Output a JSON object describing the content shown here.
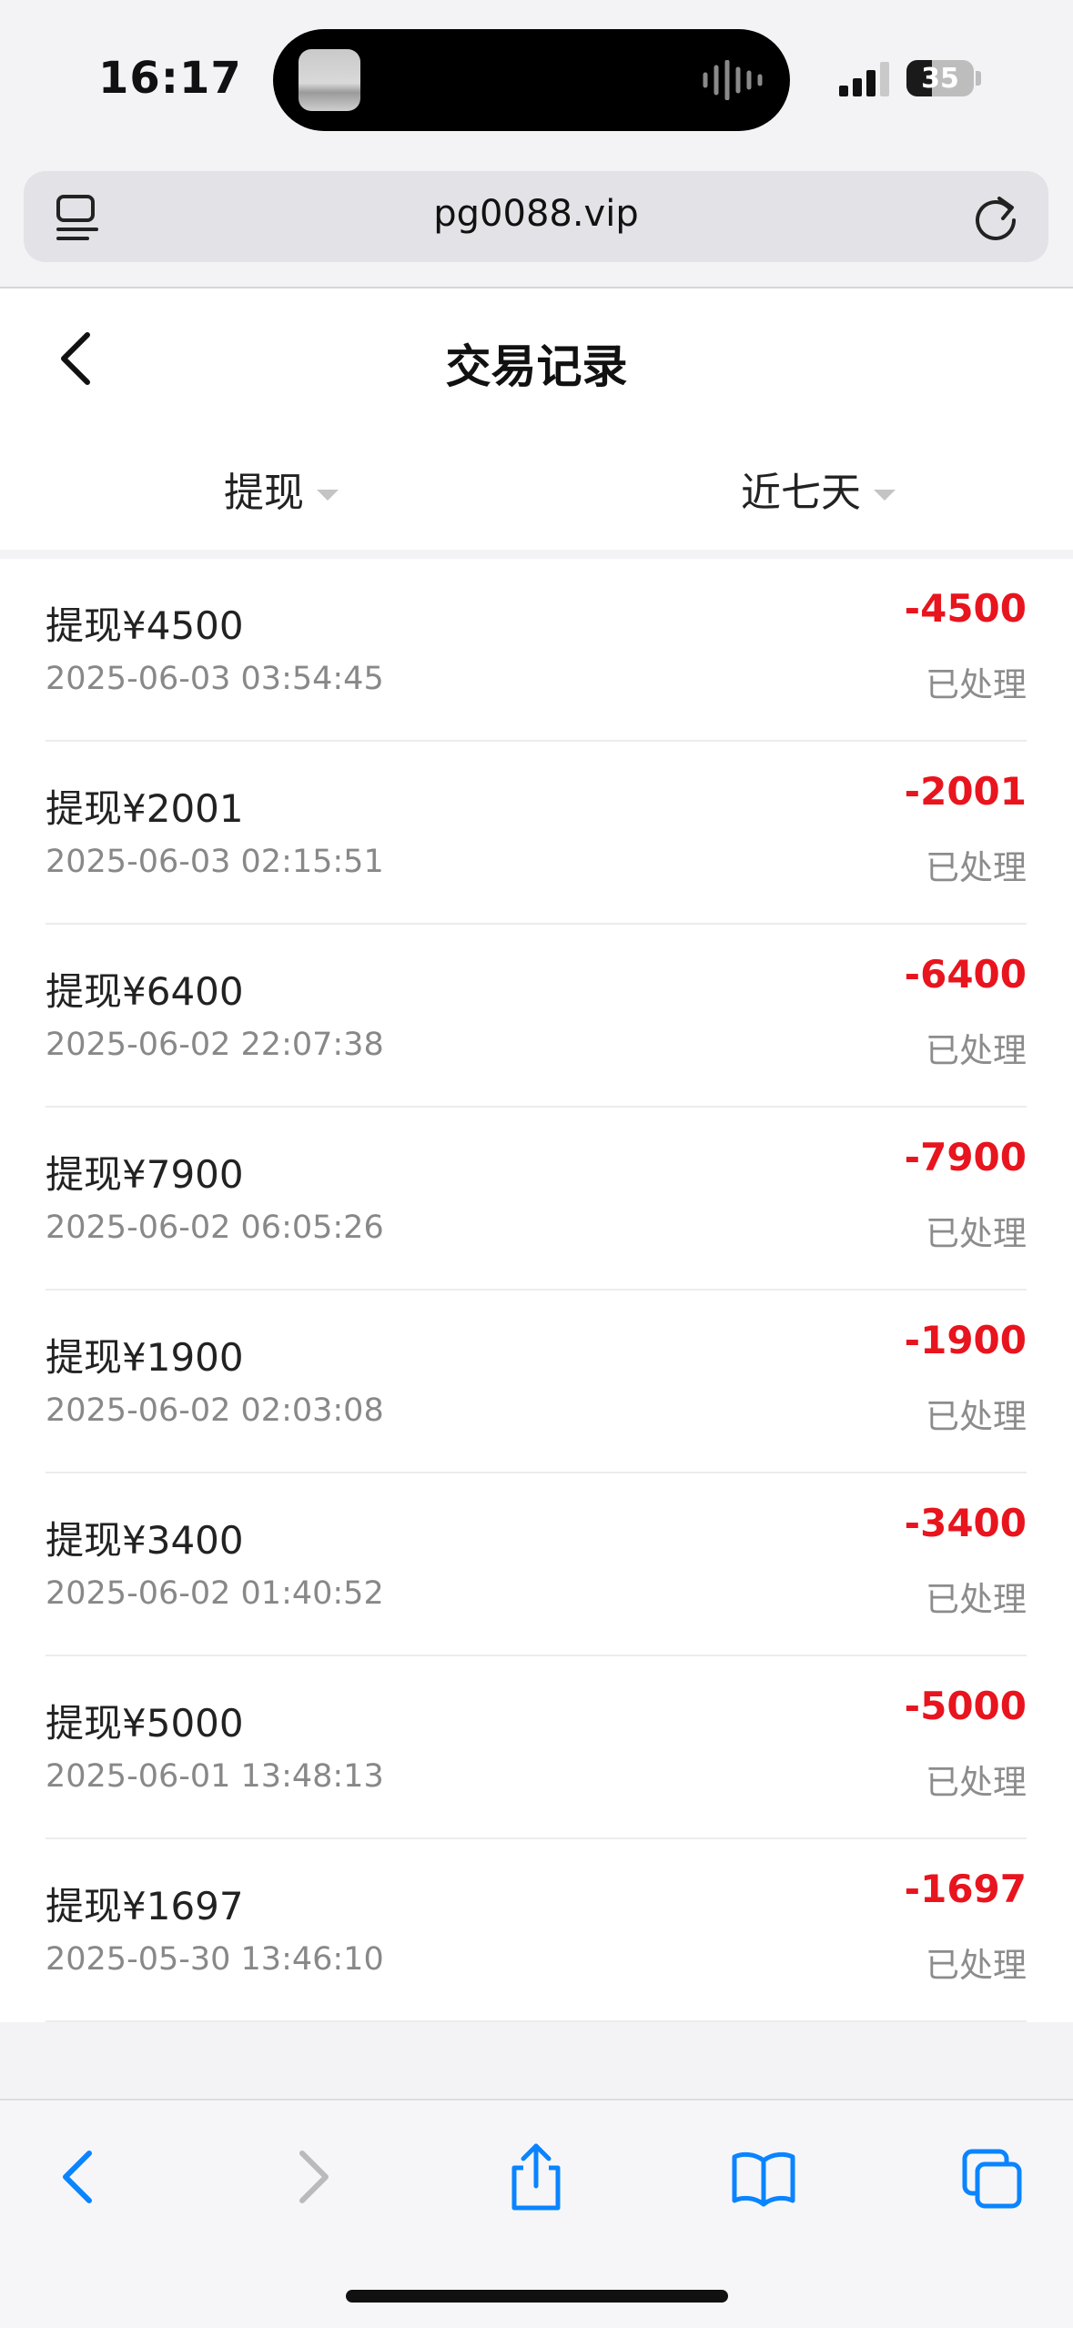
{
  "status_bar": {
    "time": "16:17",
    "battery": "35"
  },
  "browser": {
    "url": "pg0088.vip"
  },
  "page": {
    "title": "交易记录"
  },
  "filters": {
    "type": "提现",
    "period": "近七天"
  },
  "transactions": [
    {
      "title": "提现¥4500",
      "time": "2025-06-03 03:54:45",
      "amount": "-4500",
      "status": "已处理"
    },
    {
      "title": "提现¥2001",
      "time": "2025-06-03 02:15:51",
      "amount": "-2001",
      "status": "已处理"
    },
    {
      "title": "提现¥6400",
      "time": "2025-06-02 22:07:38",
      "amount": "-6400",
      "status": "已处理"
    },
    {
      "title": "提现¥7900",
      "time": "2025-06-02 06:05:26",
      "amount": "-7900",
      "status": "已处理"
    },
    {
      "title": "提现¥1900",
      "time": "2025-06-02 02:03:08",
      "amount": "-1900",
      "status": "已处理"
    },
    {
      "title": "提现¥3400",
      "time": "2025-06-02 01:40:52",
      "amount": "-3400",
      "status": "已处理"
    },
    {
      "title": "提现¥5000",
      "time": "2025-06-01 13:48:13",
      "amount": "-5000",
      "status": "已处理"
    },
    {
      "title": "提现¥1697",
      "time": "2025-05-30 13:46:10",
      "amount": "-1697",
      "status": "已处理"
    }
  ],
  "colors": {
    "amount": "#e8141e",
    "accent": "#0a84ff",
    "muted": "#888888"
  },
  "icons": {
    "back": "chevron-left-icon",
    "forward": "chevron-right-icon",
    "share": "share-icon",
    "bookmarks": "book-icon",
    "tabs": "tabs-icon",
    "reload": "reload-icon"
  }
}
